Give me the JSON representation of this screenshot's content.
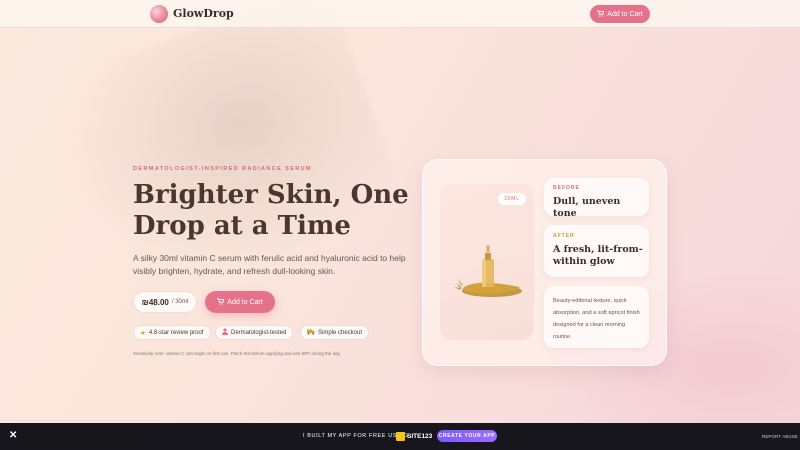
{
  "brand": {
    "name": "GlowDrop"
  },
  "header": {
    "cart_label": "Add to Cart"
  },
  "hero": {
    "eyebrow": "DERMATOLOGIST-INSPIRED RADIANCE SERUM",
    "headline": "Brighter Skin, One Drop at a Time",
    "subtitle": "A silky 30ml vitamin C serum with ferulic acid and hyaluronic acid to help visibly brighten, hydrate, and refresh dull-looking skin.",
    "price": "₪48.00",
    "price_unit": "/ 30ml",
    "cart_label": "Add to Cart",
    "badges": [
      {
        "icon": "star-icon",
        "label": "4.8-star review proof"
      },
      {
        "icon": "person-icon",
        "label": "Dermatologist-tested"
      },
      {
        "icon": "truck-icon",
        "label": "Simple checkout"
      }
    ],
    "note": "Sensitivity note: vitamin C can tingle on first use. Patch test before applying and use SPF during the day."
  },
  "product_card": {
    "size": "30ML",
    "before_label": "BEFORE",
    "before_title": "Dull, uneven tone",
    "after_label": "AFTER",
    "after_title": "A fresh, lit-from-within glow",
    "description": "Beauty-editorial texture, quick absorption, and a soft apricot finish designed for a clean morning routine."
  },
  "bottom_bar": {
    "built_text": "I BUILT MY APP FOR FREE USING",
    "site_logo_text": "SITE123",
    "create_label": "CREATE YOUR APP",
    "report_label": "REPORT ABUSE"
  },
  "colors": {
    "accent": "#e5718a",
    "eyebrow": "#d46a7a",
    "after_label": "#c9972f",
    "bar": "#16161c",
    "create_btn": "#8a64ff"
  }
}
